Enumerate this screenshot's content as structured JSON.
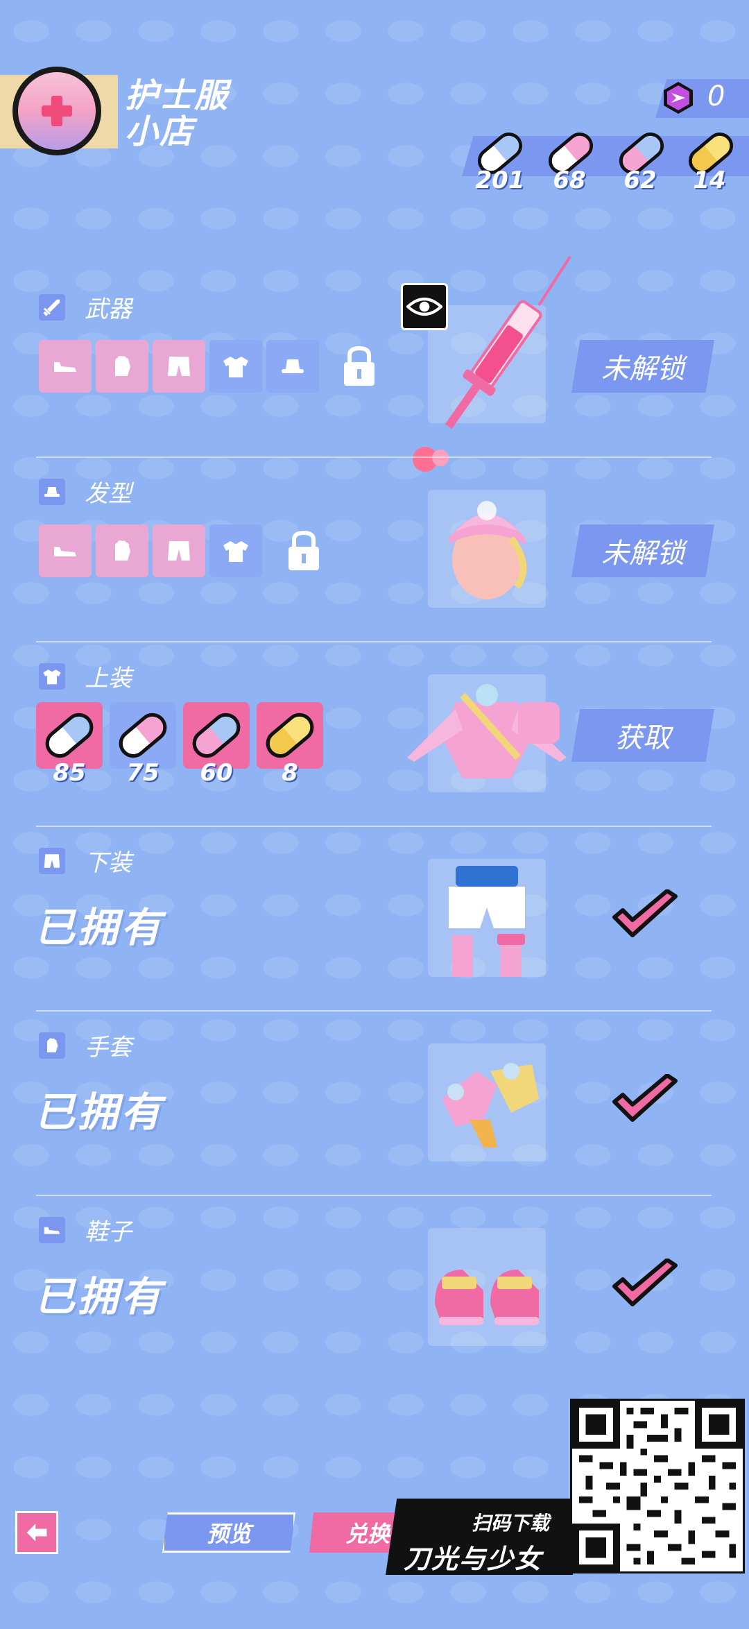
{
  "header": {
    "title_line1": "护士服",
    "title_line2": "小店",
    "gem_count": "0",
    "currencies": [
      {
        "icon": "pill-blue-icon",
        "count": "201"
      },
      {
        "icon": "pill-pink-icon",
        "count": "68"
      },
      {
        "icon": "pill-pinkblue-icon",
        "count": "62"
      },
      {
        "icon": "pill-gold-icon",
        "count": "14"
      }
    ]
  },
  "sections": [
    {
      "key": "weapon",
      "icon": "sword-icon",
      "label": "武器",
      "status": "未解锁",
      "preview": "syringe"
    },
    {
      "key": "hair",
      "icon": "hat-icon",
      "label": "发型",
      "status": "未解锁",
      "preview": "nurse-cap"
    },
    {
      "key": "top",
      "icon": "shirt-icon",
      "label": "上装",
      "status": "获取",
      "preview": "nurse-top",
      "costs": [
        {
          "icon": "pill-blue-icon",
          "count": "85"
        },
        {
          "icon": "pill-pink-icon",
          "count": "75"
        },
        {
          "icon": "pill-pinkblue-icon",
          "count": "60"
        },
        {
          "icon": "pill-gold-icon",
          "count": "8"
        }
      ]
    },
    {
      "key": "bottom",
      "icon": "shorts-icon",
      "label": "下装",
      "status": "已拥有",
      "preview": "shorts"
    },
    {
      "key": "gloves",
      "icon": "glove-icon",
      "label": "手套",
      "status": "已拥有",
      "preview": "gloves"
    },
    {
      "key": "shoes",
      "icon": "shoe-icon",
      "label": "鞋子",
      "status": "已拥有",
      "preview": "shoes"
    }
  ],
  "bottom": {
    "preview_label": "预览",
    "exchange_label": "兑换",
    "promo_sub": "扫码下载",
    "promo_title": "刀光与少女"
  },
  "colors": {
    "background": "#8fb3f3",
    "accent_blue": "#7b97f0",
    "accent_pink": "#f06aa3",
    "slot_pink": "#e9a7d4"
  }
}
